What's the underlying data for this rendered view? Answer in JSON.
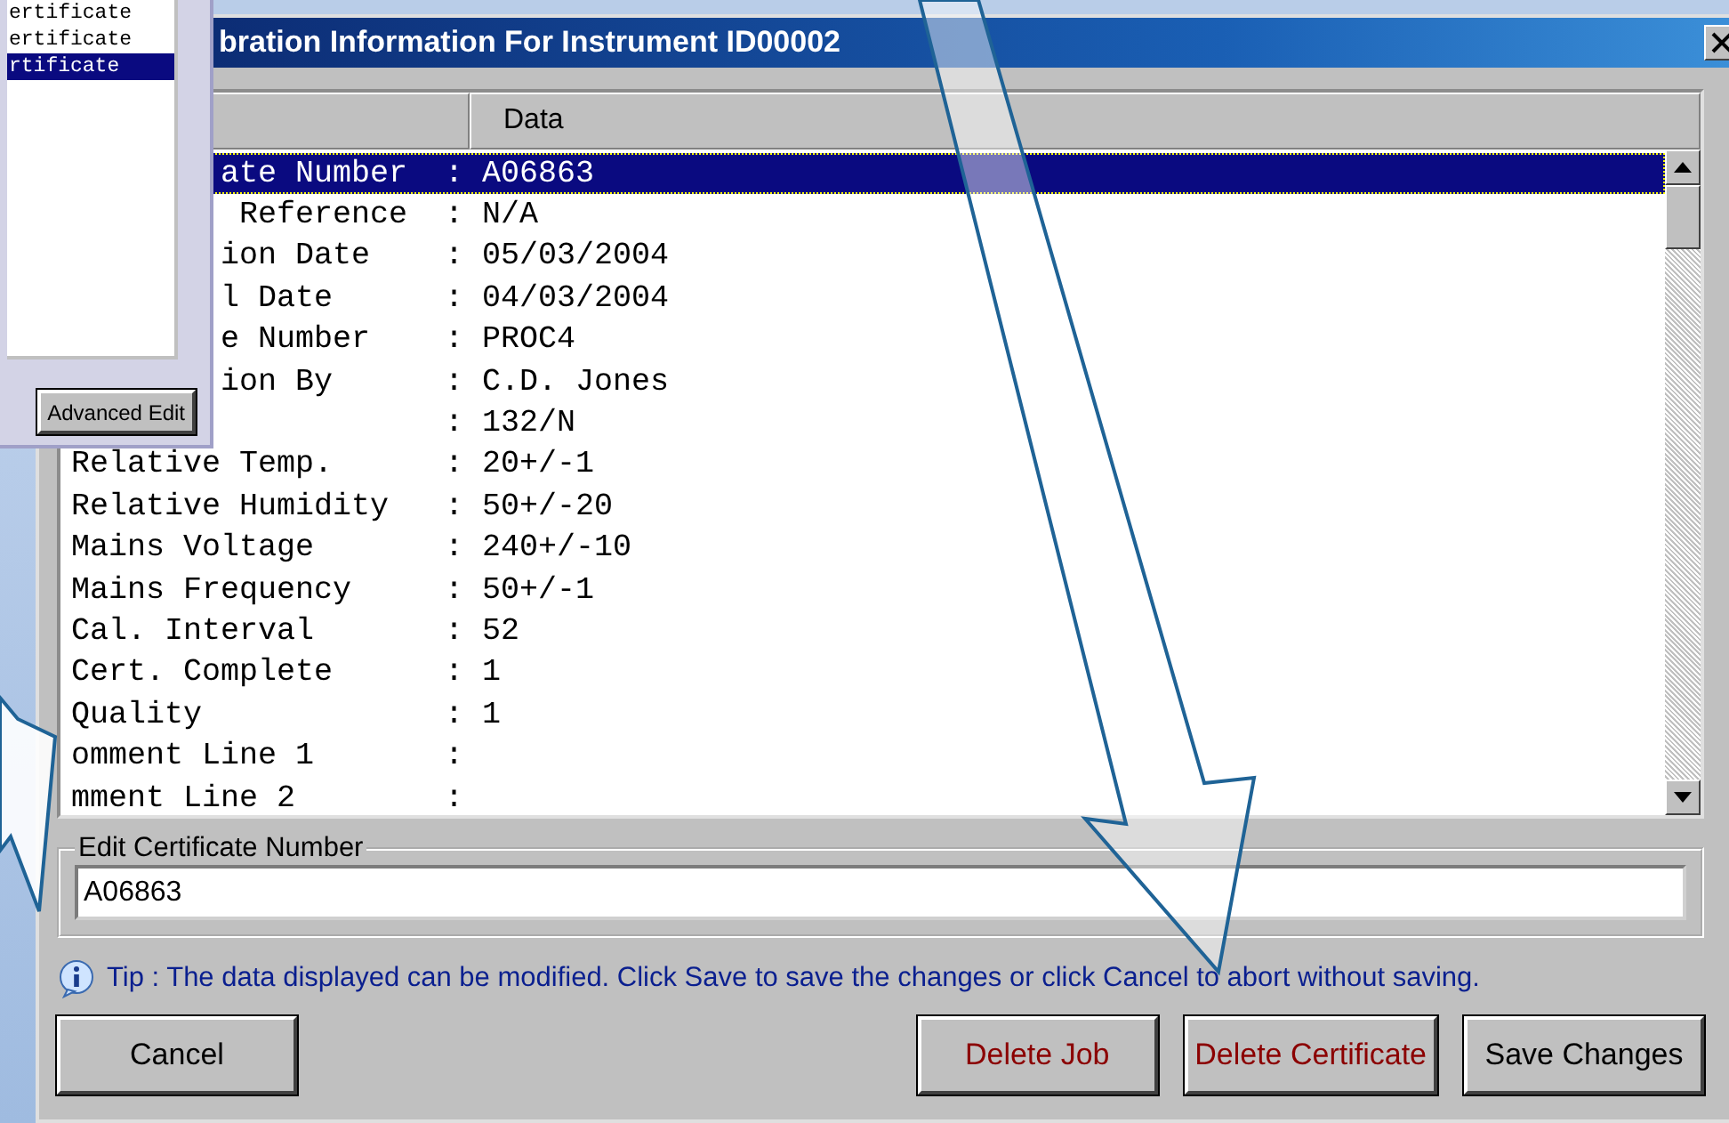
{
  "back_window": {
    "items": [
      {
        "label": "ertificate",
        "selected": false
      },
      {
        "label": "ertificate",
        "selected": false
      },
      {
        "label": "rtificate",
        "selected": true
      }
    ],
    "button": "Advanced Edit"
  },
  "window": {
    "title": "bration Information For Instrument ID00002"
  },
  "table": {
    "columns": [
      "",
      "Data"
    ],
    "rows": [
      {
        "kind": "clipped",
        "label": "ate Number",
        "sep": ":",
        "value": "A06863",
        "selected": true
      },
      {
        "kind": "clipped",
        "label": " Reference",
        "sep": ":",
        "value": "N/A",
        "selected": false
      },
      {
        "kind": "clipped",
        "label": "ion Date",
        "sep": ":",
        "value": "05/03/2004",
        "selected": false
      },
      {
        "kind": "clipped",
        "label": "l Date",
        "sep": ":",
        "value": "04/03/2004",
        "selected": false
      },
      {
        "kind": "clipped",
        "label": "e Number",
        "sep": ":",
        "value": "PROC4",
        "selected": false
      },
      {
        "kind": "clipped",
        "label": "ion By",
        "sep": ":",
        "value": "C.D. Jones",
        "selected": false
      },
      {
        "kind": "clipped",
        "label": "",
        "sep": ":",
        "value": "132/N",
        "selected": false
      },
      {
        "kind": "full",
        "label": "Relative Temp.",
        "sep": ":",
        "value": "20+/-1",
        "selected": false
      },
      {
        "kind": "full",
        "label": "Relative Humidity",
        "sep": ":",
        "value": "50+/-20",
        "selected": false
      },
      {
        "kind": "full",
        "label": "Mains Voltage",
        "sep": ":",
        "value": "240+/-10",
        "selected": false
      },
      {
        "kind": "full",
        "label": "Mains Frequency",
        "sep": ":",
        "value": "50+/-1",
        "selected": false
      },
      {
        "kind": "full",
        "label": "Cal. Interval",
        "sep": ":",
        "value": "52",
        "selected": false
      },
      {
        "kind": "full",
        "label": "Cert. Complete",
        "sep": ":",
        "value": "1",
        "selected": false
      },
      {
        "kind": "full",
        "label": "Quality",
        "sep": ":",
        "value": "1",
        "selected": false
      },
      {
        "kind": "full",
        "label": "omment Line 1",
        "sep": ":",
        "value": "",
        "selected": false
      },
      {
        "kind": "full",
        "label": "mment Line 2",
        "sep": ":",
        "value": "",
        "selected": false
      }
    ]
  },
  "edit": {
    "legend": "Edit Certificate Number",
    "value": "A06863"
  },
  "tip": "Tip : The data displayed can be modified. Click Save to save the changes or click Cancel to abort without saving.",
  "buttons": [
    {
      "kind": "neutral",
      "label": "Cancel"
    },
    {
      "kind": "danger",
      "label": "Delete Job"
    },
    {
      "kind": "danger",
      "label": "Delete Certificate"
    },
    {
      "kind": "neutral",
      "label": "Save Changes"
    }
  ]
}
